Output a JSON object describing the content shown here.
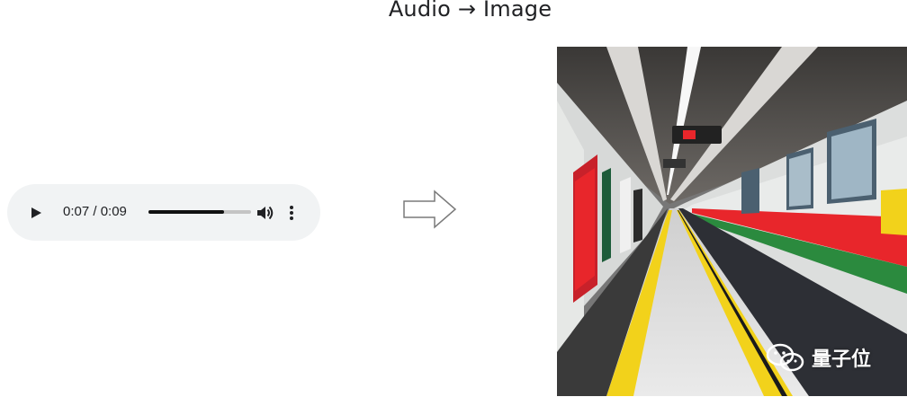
{
  "title": "Audio → Image",
  "player": {
    "current_time": "0:07",
    "duration": "0:09",
    "time_display": "0:07 / 0:09",
    "progress": 0.74,
    "play_icon": "play-icon",
    "volume_icon": "volume-icon",
    "menu_icon": "more-vert-icon"
  },
  "arrow_icon": "right-arrow-icon",
  "image": {
    "description_icon": "subway-platform-photo"
  },
  "watermark": {
    "text": "量子位",
    "icon": "wechat-icon"
  },
  "colors": {
    "player_bg": "#f1f3f4",
    "train_red": "#e8262b",
    "platform_yellow": "#f2d21b"
  }
}
